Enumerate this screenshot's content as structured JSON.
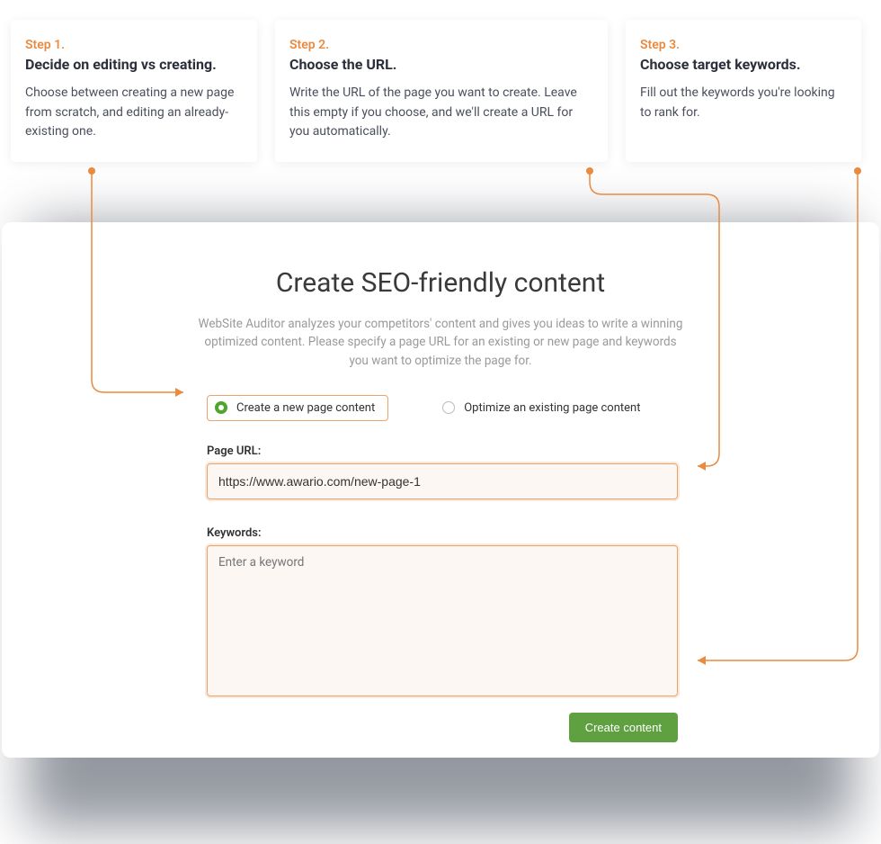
{
  "steps": [
    {
      "num": "Step 1.",
      "title": "Decide on editing vs creating.",
      "desc": "Choose between creating a new page from scratch, and editing an already-existing one."
    },
    {
      "num": "Step 2.",
      "title": "Choose the URL.",
      "desc": "Write the URL of the page you want to create. Leave this empty if you choose, and we'll create a URL for you automatically."
    },
    {
      "num": "Step 3.",
      "title": "Choose target keywords.",
      "desc": "Fill out the keywords you're looking to rank for."
    }
  ],
  "main": {
    "title": "Create SEO-friendly content",
    "desc": "WebSite Auditor analyzes your competitors' content and gives you ideas to write a winning optimized content. Please specify a page URL for an existing or new page and keywords you want to optimize the page for.",
    "option_create": "Create a new page content",
    "option_optimize": "Optimize an existing page content",
    "url_label": "Page URL:",
    "url_value": "https://www.awario.com/new-page-1",
    "kw_label": "Keywords:",
    "kw_placeholder": "Enter a keyword",
    "submit": "Create content"
  },
  "colors": {
    "accent": "#e98a3f",
    "green": "#5fa141"
  }
}
